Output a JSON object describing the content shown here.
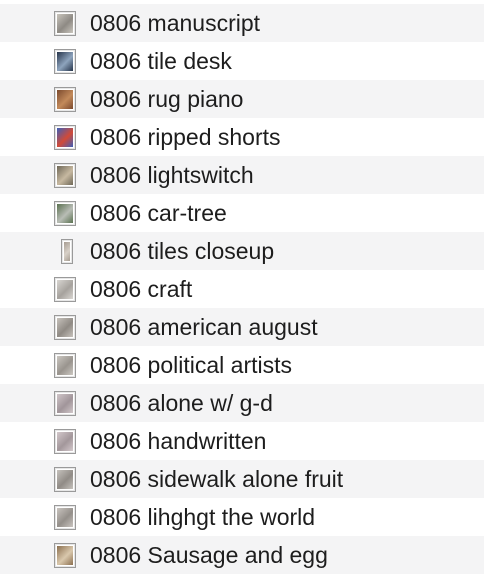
{
  "files": [
    {
      "name": "0806 manuscript",
      "thumbnail": "photo-document-thumbnail",
      "colors": [
        "#c9c5bd",
        "#8e8a84"
      ]
    },
    {
      "name": "0806 tile desk",
      "thumbnail": "photo-desk-thumbnail",
      "colors": [
        "#26344a",
        "#8ea4bd"
      ]
    },
    {
      "name": "0806 rug piano",
      "thumbnail": "photo-rug-thumbnail",
      "colors": [
        "#7b4a2e",
        "#c38a5b"
      ]
    },
    {
      "name": "0806 ripped shorts",
      "thumbnail": "photo-shorts-thumbnail",
      "colors": [
        "#3e5fb8",
        "#d24a37"
      ]
    },
    {
      "name": "0806 lightswitch",
      "thumbnail": "photo-lightswitch-thumbnail",
      "colors": [
        "#6e6757",
        "#c7b9a1"
      ]
    },
    {
      "name": "0806 car-tree",
      "thumbnail": "photo-car-tree-thumbnail",
      "colors": [
        "#5a7150",
        "#b9bdb6"
      ]
    },
    {
      "name": "0806 tiles closeup",
      "thumbnail": "photo-tiles-thumbnail",
      "colors": [
        "#a79d92",
        "#d8d1c8"
      ]
    },
    {
      "name": "0806 craft",
      "thumbnail": "document-page-thumbnail",
      "colors": [
        "#d9d6d2",
        "#a6a29d"
      ]
    },
    {
      "name": "0806 american august",
      "thumbnail": "document-page-thumbnail",
      "colors": [
        "#c7c2bc",
        "#8f8a84"
      ]
    },
    {
      "name": "0806 political artists",
      "thumbnail": "document-page-thumbnail",
      "colors": [
        "#cbc7c1",
        "#99948e"
      ]
    },
    {
      "name": "0806 alone w/ g-d",
      "thumbnail": "document-page-thumbnail",
      "colors": [
        "#d0c6c9",
        "#a1959a"
      ]
    },
    {
      "name": "0806 handwritten",
      "thumbnail": "document-page-thumbnail",
      "colors": [
        "#d3c8cb",
        "#a3979b"
      ]
    },
    {
      "name": "0806 sidewalk alone fruit",
      "thumbnail": "document-page-thumbnail",
      "colors": [
        "#c6c2bd",
        "#908b86"
      ]
    },
    {
      "name": "0806 lihghgt the world",
      "thumbnail": "document-page-thumbnail",
      "colors": [
        "#c9c4bf",
        "#948f8a"
      ]
    },
    {
      "name": "0806 Sausage and egg",
      "thumbnail": "photo-food-thumbnail",
      "colors": [
        "#8b6f4f",
        "#d9c8ad"
      ]
    }
  ]
}
